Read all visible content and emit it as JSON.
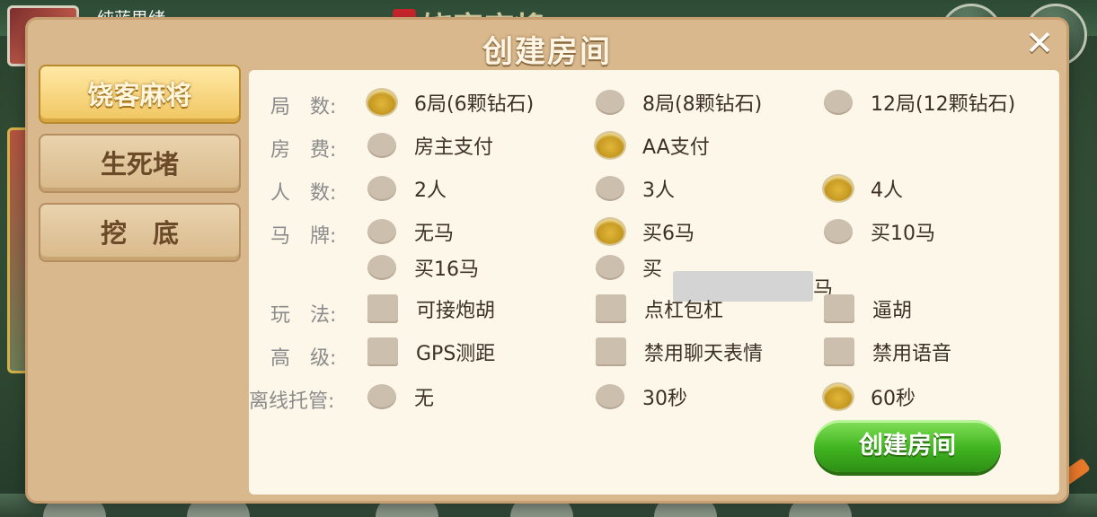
{
  "background": {
    "player_name": "纯蓝思绪",
    "logo_text": "饶客麻将",
    "accent_color": "#f0c560",
    "confirm_color": "#3fb31f"
  },
  "dialog": {
    "title": "创建房间",
    "close_label": "✕",
    "create_button": "创建房间"
  },
  "tabs": [
    {
      "label": "饶客麻将",
      "active": true
    },
    {
      "label": "生死堵",
      "active": false
    },
    {
      "label": "挖　底",
      "active": false
    }
  ],
  "rows": {
    "rounds": {
      "label": "局　数:",
      "options": [
        "6局(6颗钻石)",
        "8局(8颗钻石)",
        "12局(12颗钻石)"
      ],
      "selected": 0
    },
    "fee": {
      "label": "房　费:",
      "options": [
        "房主支付",
        "AA支付"
      ],
      "selected": 1
    },
    "players": {
      "label": "人　数:",
      "options": [
        "2人",
        "3人",
        "4人"
      ],
      "selected": 2
    },
    "horse": {
      "label": "马　牌:",
      "options": [
        "无马",
        "买6马",
        "买10马",
        "买16马",
        "买"
      ],
      "custom_suffix": "马",
      "custom_value": "",
      "selected": 1
    },
    "play": {
      "label": "玩　法:",
      "options": [
        "可接炮胡",
        "点杠包杠",
        "逼胡"
      ],
      "checked": [
        false,
        false,
        false
      ]
    },
    "advanced": {
      "label": "高　级:",
      "options": [
        "GPS测距",
        "禁用聊天表情",
        "禁用语音"
      ],
      "checked": [
        false,
        false,
        false
      ]
    },
    "offline": {
      "label": "离线托管:",
      "options": [
        "无",
        "30秒",
        "60秒"
      ],
      "selected": 2
    }
  }
}
